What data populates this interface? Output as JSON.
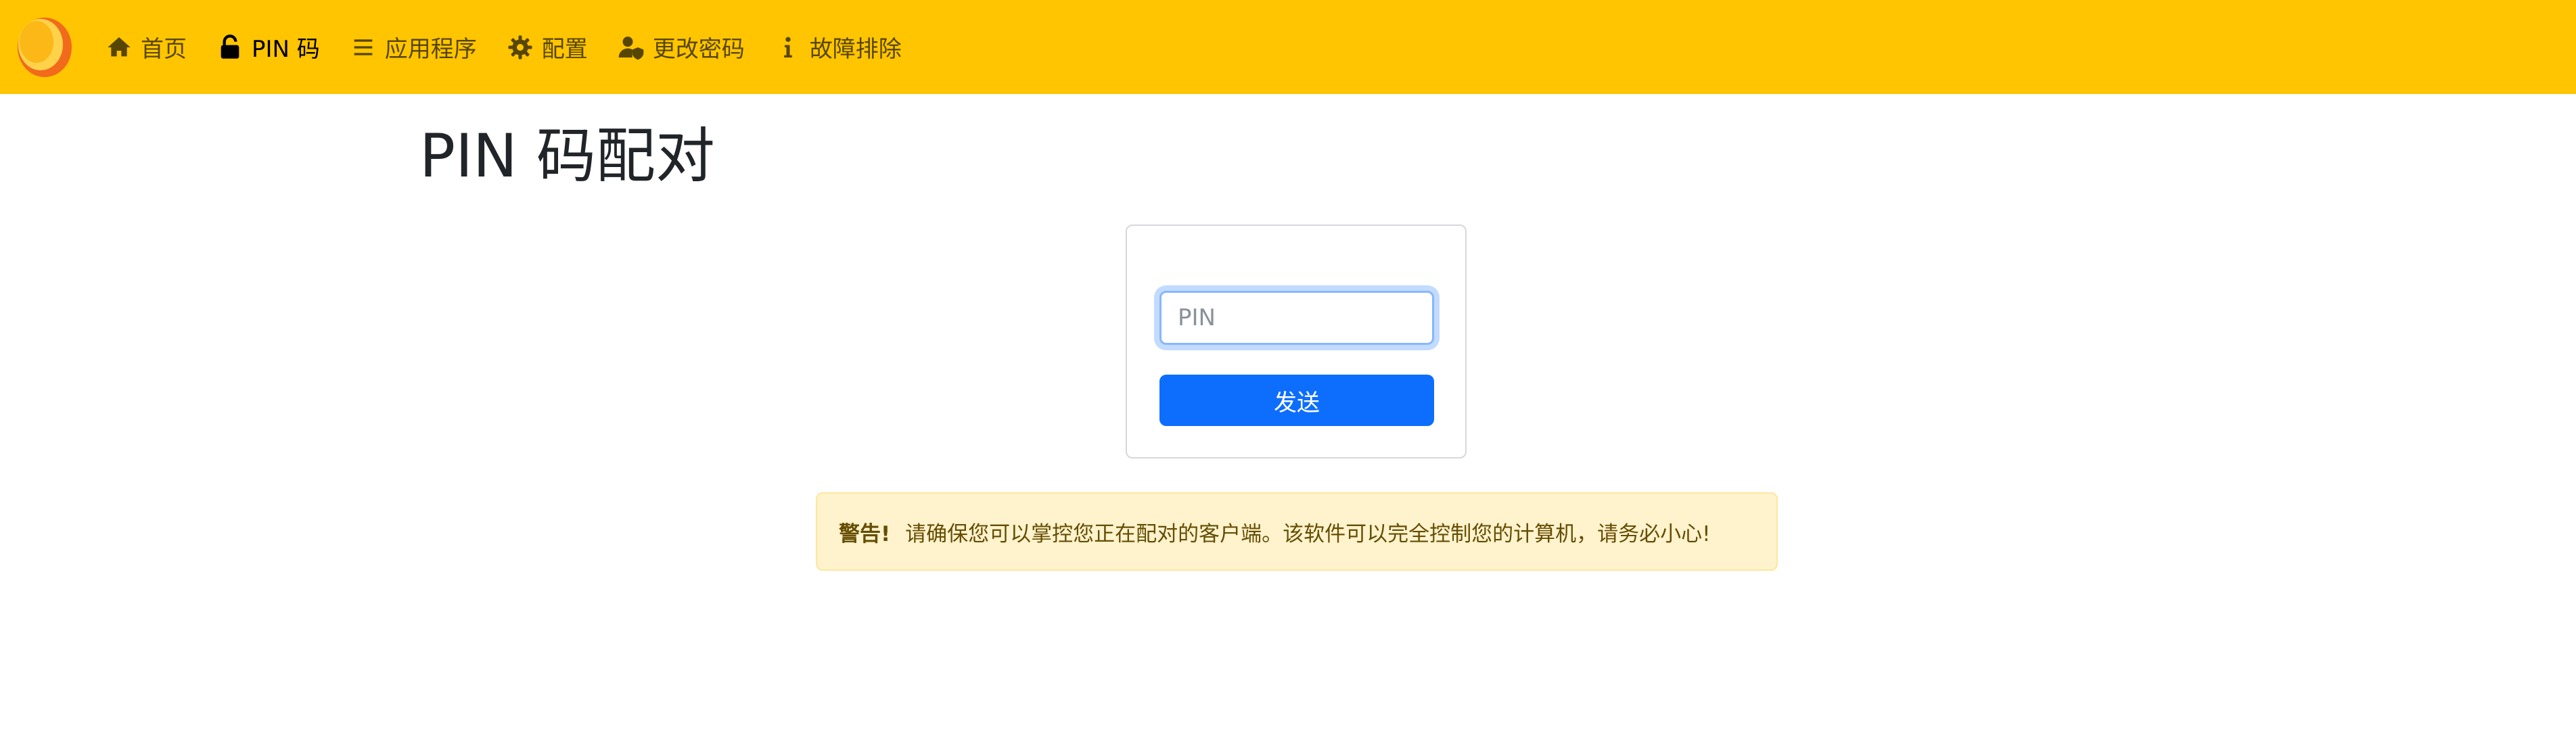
{
  "nav": {
    "logo_icon": "sunshine-logo",
    "items": [
      {
        "label": "首页",
        "icon": "home-icon"
      },
      {
        "label": "PIN 码",
        "icon": "unlock-icon"
      },
      {
        "label": "应用程序",
        "icon": "list-icon"
      },
      {
        "label": "配置",
        "icon": "gear-icon"
      },
      {
        "label": "更改密码",
        "icon": "user-shield-icon"
      },
      {
        "label": "故障排除",
        "icon": "info-icon"
      }
    ],
    "active_item": "PIN 码"
  },
  "page": {
    "title": "PIN 码配对"
  },
  "form": {
    "pin_placeholder": "PIN",
    "pin_value": "",
    "send_label": "发送"
  },
  "alert": {
    "prefix": "警告!",
    "message": "请确保您可以掌控您正在配对的客户端。该软件可以完全控制您的计算机，请务必小心!"
  },
  "colors": {
    "navbar": "#ffc500",
    "primary": "#0d6efd",
    "warning_bg": "#fff3cd",
    "warning_text": "#664d03"
  }
}
